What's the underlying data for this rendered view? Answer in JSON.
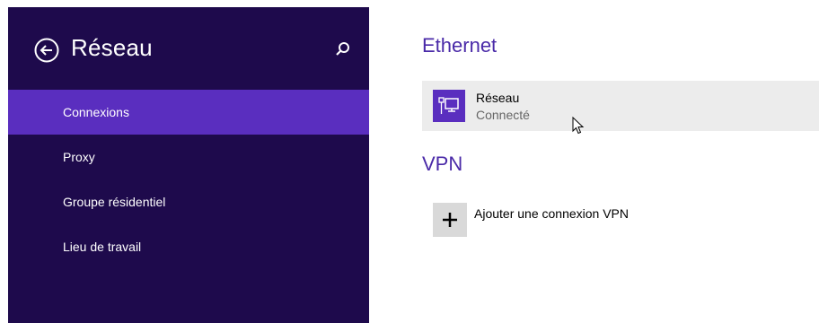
{
  "sidebar": {
    "title": "Réseau",
    "back_icon": "back-arrow-circle-icon",
    "search_icon": "search-icon",
    "items": [
      {
        "label": "Connexions",
        "active": true
      },
      {
        "label": "Proxy",
        "active": false
      },
      {
        "label": "Groupe résidentiel",
        "active": false
      },
      {
        "label": "Lieu de travail",
        "active": false
      }
    ]
  },
  "main": {
    "ethernet": {
      "title": "Ethernet",
      "connection": {
        "name": "Réseau",
        "status": "Connecté",
        "icon": "ethernet-network-icon"
      }
    },
    "vpn": {
      "title": "VPN",
      "add_label": "Ajouter une connexion VPN",
      "add_icon": "plus-icon"
    }
  },
  "colors": {
    "sidebar_bg": "#1e0a4c",
    "accent": "#5a2ebf",
    "section_title": "#4a2aa8",
    "item_bg": "#ececec"
  }
}
